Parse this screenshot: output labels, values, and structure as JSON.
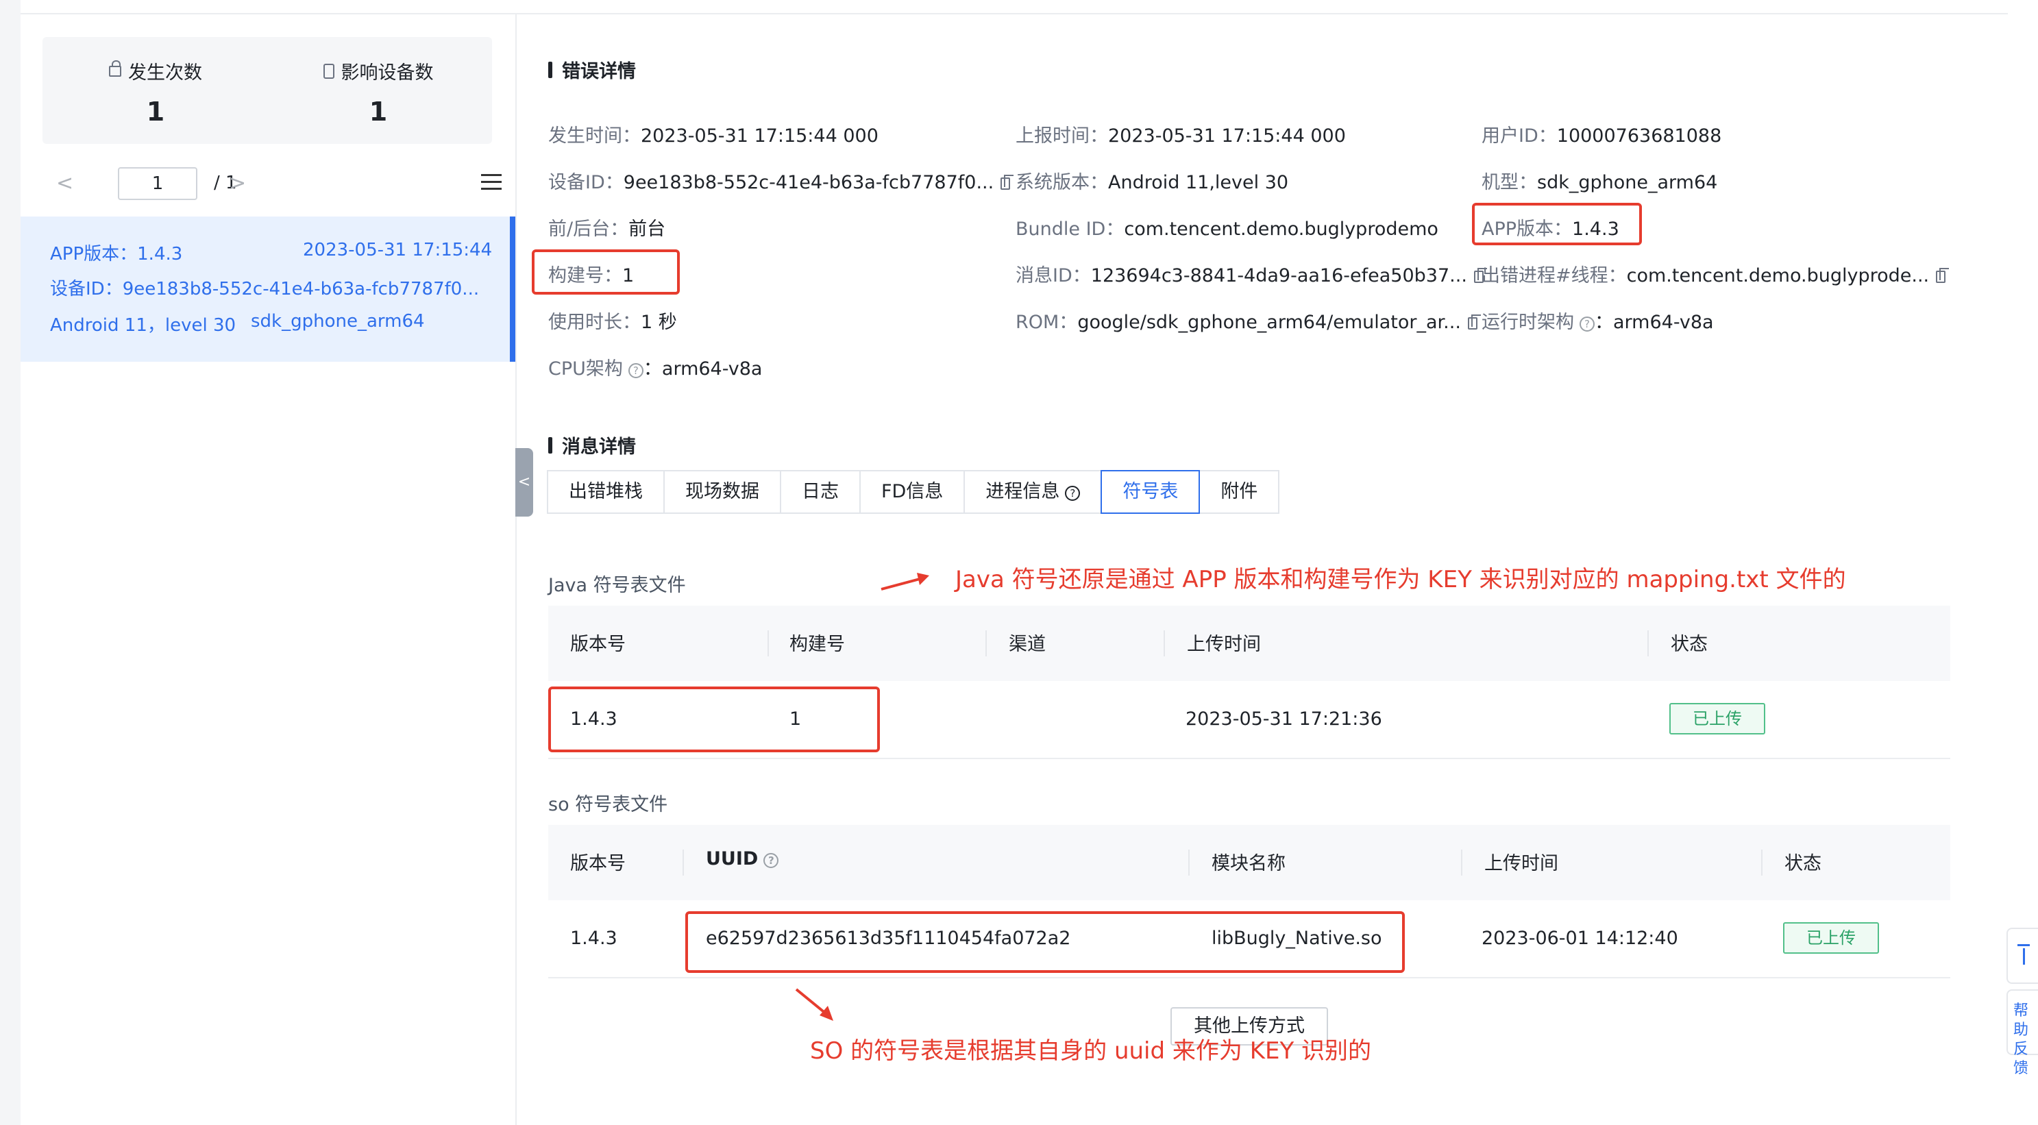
{
  "sidebar": {
    "stats": [
      {
        "label": "发生次数",
        "value": "1",
        "icon": "lock-icon"
      },
      {
        "label": "影响设备数",
        "value": "1",
        "icon": "phone-icon"
      }
    ],
    "pager": {
      "prev": "<",
      "current": "1",
      "total": "/  1",
      "next": ">"
    },
    "record": {
      "app_version": "APP版本：1.4.3",
      "time": "2023-05-31 17:15:44",
      "device": "设备ID：9ee183b8-552c-41e4-b63a-fcb7787f0...",
      "os": "Android 11，level 30",
      "model": "sdk_gphone_arm64"
    },
    "collapse": "<"
  },
  "error_detail": {
    "title": "错误详情",
    "fields": [
      {
        "k": "发生时间：",
        "v": "2023-05-31 17:15:44 000"
      },
      {
        "k": "上报时间：",
        "v": "2023-05-31 17:15:44 000"
      },
      {
        "k": "用户ID：",
        "v": "10000763681088"
      },
      {
        "k": "设备ID：",
        "v": "9ee183b8-552c-41e4-b63a-fcb7787f0..."
      },
      {
        "k": "系统版本：",
        "v": "Android 11,level 30"
      },
      {
        "k": "机型：",
        "v": "sdk_gphone_arm64"
      },
      {
        "k": "前/后台：",
        "v": "前台"
      },
      {
        "k": "Bundle ID：",
        "v": "com.tencent.demo.buglyprodemo"
      },
      {
        "k": "APP版本：",
        "v": "1.4.3"
      },
      {
        "k": "构建号：",
        "v": "1"
      },
      {
        "k": "消息ID：",
        "v": "123694c3-8841-4da9-aa16-efea50b37..."
      },
      {
        "k": "出错进程#线程：",
        "v": "com.tencent.demo.buglyprode..."
      },
      {
        "k": "使用时长：",
        "v": "1 秒"
      },
      {
        "k": "ROM：",
        "v": "google/sdk_gphone_arm64/emulator_ar..."
      },
      {
        "k": "运行时架构",
        "v": "：arm64-v8a"
      },
      {
        "k": "CPU架构",
        "v": "：arm64-v8a"
      }
    ]
  },
  "message_detail": {
    "title": "消息详情",
    "tabs": [
      "出错堆栈",
      "现场数据",
      "日志",
      "FD信息",
      "进程信息",
      "符号表",
      "附件"
    ],
    "active_tab": "符号表"
  },
  "java_table": {
    "title": "Java 符号表文件",
    "headers": [
      "版本号",
      "构建号",
      "渠道",
      "上传时间",
      "状态"
    ],
    "row": {
      "version": "1.4.3",
      "build": "1",
      "channel": "",
      "time": "2023-05-31 17:21:36",
      "status": "已上传"
    }
  },
  "so_table": {
    "title": "so 符号表文件",
    "headers": [
      "版本号",
      "UUID",
      "模块名称",
      "上传时间",
      "状态"
    ],
    "row": {
      "version": "1.4.3",
      "uuid": "e62597d2365613d35f1110454fa072a2",
      "module": "libBugly_Native.so",
      "time": "2023-06-01 14:12:40",
      "status": "已上传"
    }
  },
  "other_upload": "其他上传方式",
  "annotations": {
    "java": "Java 符号还原是通过 APP 版本和构建号作为 KEY 来识别对应的 mapping.txt 文件的",
    "so": "SO 的符号表是根据其自身的 uuid 来作为 KEY 识别的"
  },
  "float_help": "帮助反馈",
  "colors": {
    "accent": "#2f6feb",
    "annotation": "#e63c2e",
    "success": "#2ba267"
  }
}
